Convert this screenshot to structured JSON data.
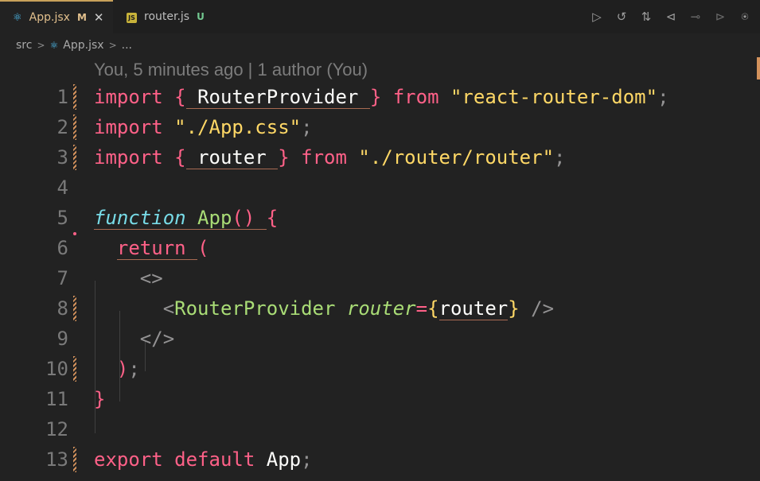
{
  "tabs": [
    {
      "label": "App.jsx",
      "badge": "M",
      "icon": "react-icon"
    },
    {
      "label": "router.js",
      "badge": "U",
      "icon": "js-file-icon"
    }
  ],
  "breadcrumb": {
    "folder": "src",
    "file": "App.jsx",
    "more": "..."
  },
  "codelens": "You, 5 minutes ago | 1 author (You)",
  "line_numbers": [
    "1",
    "2",
    "3",
    "4",
    "5",
    "6",
    "7",
    "8",
    "9",
    "10",
    "11",
    "12",
    "13"
  ],
  "code": {
    "l1": {
      "kw": "import",
      "open": "{",
      "name": "RouterProvider",
      "close": "}",
      "from": "from",
      "src": "\"react-router-dom\"",
      "semi": ";"
    },
    "l2": {
      "kw": "import",
      "src": "\"./App.css\"",
      "semi": ";"
    },
    "l3": {
      "kw": "import",
      "open": "{",
      "name": "router",
      "close": "}",
      "from": "from",
      "src": "\"./router/router\"",
      "semi": ";"
    },
    "l5": {
      "kw": "function",
      "name": "App",
      "parens": "()",
      "brace": "{"
    },
    "l6": {
      "kw": "return",
      "paren": "("
    },
    "l7": {
      "frag": "<>"
    },
    "l8": {
      "lt": "<",
      "tag": "RouterProvider",
      "attr": "router",
      "eq": "=",
      "ob": "{",
      "val": "router",
      "cb": "}",
      "end": "/>"
    },
    "l9": {
      "frag": "</>"
    },
    "l10": {
      "paren": ")",
      "semi": ";"
    },
    "l11": {
      "brace": "}"
    },
    "l13": {
      "kw1": "export",
      "kw2": "default",
      "name": "App",
      "semi": ";"
    }
  },
  "colors": {
    "accent": "#c8a15a",
    "modified": "#e2c08d",
    "untracked": "#73c991"
  }
}
